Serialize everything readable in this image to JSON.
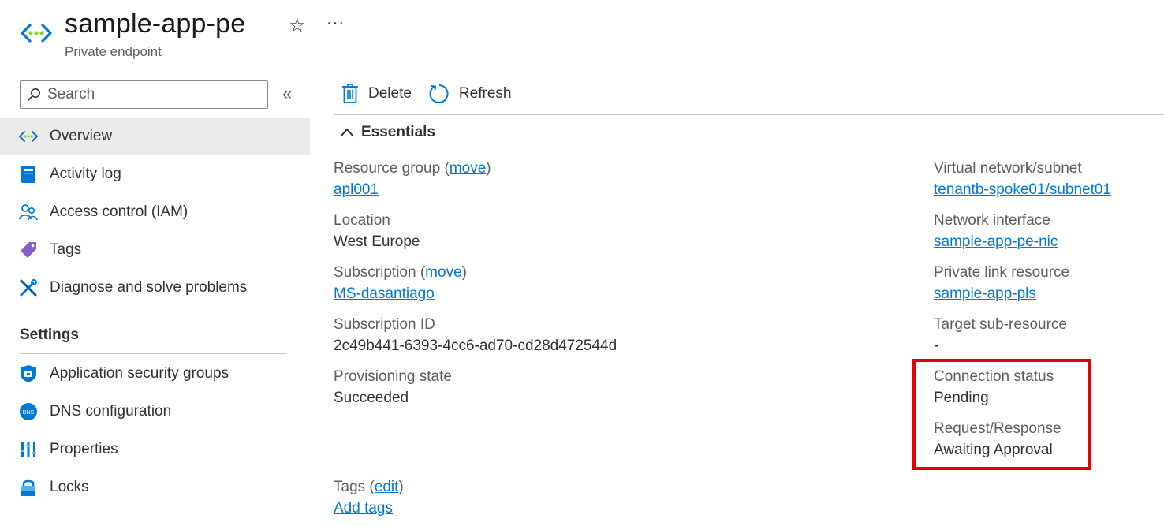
{
  "header": {
    "title": "sample-app-pe",
    "subtitle": "Private endpoint",
    "favorite_icon": "star-icon",
    "more_label": "···"
  },
  "sidebar": {
    "search_placeholder": "Search",
    "collapse_label": "«",
    "items": [
      {
        "label": "Overview",
        "icon": "private-endpoint-icon",
        "active": true
      },
      {
        "label": "Activity log",
        "icon": "activity-log-icon"
      },
      {
        "label": "Access control (IAM)",
        "icon": "iam-icon"
      },
      {
        "label": "Tags",
        "icon": "tag-icon"
      },
      {
        "label": "Diagnose and solve problems",
        "icon": "wrench-icon"
      }
    ],
    "settings_header": "Settings",
    "settings_items": [
      {
        "label": "Application security groups",
        "icon": "shield-icon"
      },
      {
        "label": "DNS configuration",
        "icon": "dns-icon"
      },
      {
        "label": "Properties",
        "icon": "properties-icon"
      },
      {
        "label": "Locks",
        "icon": "lock-icon"
      }
    ]
  },
  "toolbar": {
    "delete_label": "Delete",
    "refresh_label": "Refresh"
  },
  "essentials": {
    "header": "Essentials",
    "left": {
      "resource_group_label": "Resource group",
      "resource_group_move": "move",
      "resource_group_value": "apl001",
      "location_label": "Location",
      "location_value": "West Europe",
      "subscription_label": "Subscription",
      "subscription_move": "move",
      "subscription_value": "MS-dasantiago",
      "subscription_id_label": "Subscription ID",
      "subscription_id_value": "2c49b441-6393-4cc6-ad70-cd28d472544d",
      "provisioning_label": "Provisioning state",
      "provisioning_value": "Succeeded"
    },
    "right": {
      "vnet_label": "Virtual network/subnet",
      "vnet_value": "tenantb-spoke01/subnet01",
      "nic_label": "Network interface",
      "nic_value": "sample-app-pe-nic",
      "pls_label": "Private link resource",
      "pls_value": "sample-app-pls",
      "target_label": "Target sub-resource",
      "target_value": "-",
      "conn_status_label": "Connection status",
      "conn_status_value": "Pending",
      "req_resp_label": "Request/Response",
      "req_resp_value": "Awaiting Approval"
    },
    "tags_label": "Tags",
    "tags_edit": "edit",
    "add_tags": "Add tags"
  },
  "colors": {
    "link": "#0078d4",
    "highlight": "#e60000",
    "active_nav": "#edebe9"
  }
}
